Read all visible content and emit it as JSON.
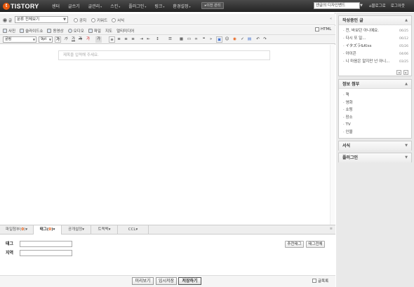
{
  "topbar": {
    "logo_mark": "t",
    "logo_text": "TISTORY",
    "menu": [
      {
        "label": "센터",
        "arrow": false
      },
      {
        "label": "글쓰기",
        "arrow": false
      },
      {
        "label": "글관리",
        "arrow": true
      },
      {
        "label": "스킨",
        "arrow": true
      },
      {
        "label": "플러그인",
        "arrow": true
      },
      {
        "label": "링크",
        "arrow": true
      },
      {
        "label": "환경설정",
        "arrow": true
      }
    ],
    "old_admin": "이전 관리",
    "blog_selector": "센글의 디자인밴드",
    "links": [
      "블로그로",
      "로그아웃"
    ]
  },
  "post_type": {
    "options": [
      "글",
      "공지",
      "키워드",
      "서식"
    ],
    "selected": "글",
    "category": "분류 전체보기"
  },
  "attach_bar": {
    "items": [
      "사진",
      "슬라이드쇼",
      "동영상",
      "오디오",
      "파일",
      "지도",
      "멀티미디어"
    ],
    "html_label": "HTML"
  },
  "format_bar": {
    "font": "굴림",
    "size": "9pt",
    "buttons": [
      "가",
      "가",
      "가",
      "가",
      "가",
      "가"
    ]
  },
  "title_placeholder": "제목을 입력해 주세요.",
  "tabs": [
    {
      "label": "파일첨부",
      "count": "0",
      "arrow": true
    },
    {
      "label": "태그",
      "count": "0",
      "arrow": true
    },
    {
      "label": "공개설정",
      "count": "",
      "arrow": true
    },
    {
      "label": "트랙백",
      "count": "",
      "arrow": true
    },
    {
      "label": "CCL",
      "count": "",
      "arrow": true
    }
  ],
  "tag_panel": {
    "tag_label": "태그",
    "location_label": "지역",
    "recommend_button": "추천태그",
    "tag_all_button": "태그전체"
  },
  "bottom": {
    "preview": "미리보기",
    "temp_save": "임시저장",
    "save": "저장하기",
    "finish_label": "글목록"
  },
  "sidebar": {
    "drafts": {
      "title": "작성중인 글",
      "items": [
        {
          "title": "전, 바보던 아니예요.",
          "date": "06/25"
        },
        {
          "title": "다시 또 일...",
          "date": "06/12"
        },
        {
          "title": "イタズラ&Kiss",
          "date": "05/26"
        },
        {
          "title": "아이콘",
          "date": "04/06"
        },
        {
          "title": "니 마음은 알지만 넌 아니...",
          "date": "03/25"
        }
      ]
    },
    "info": {
      "title": "정보 첨부",
      "items": [
        "책",
        "영화",
        "쇼핑",
        "장소",
        "TV",
        "인물"
      ]
    },
    "template": {
      "title": "서식"
    },
    "plugin": {
      "title": "플러그인"
    }
  }
}
